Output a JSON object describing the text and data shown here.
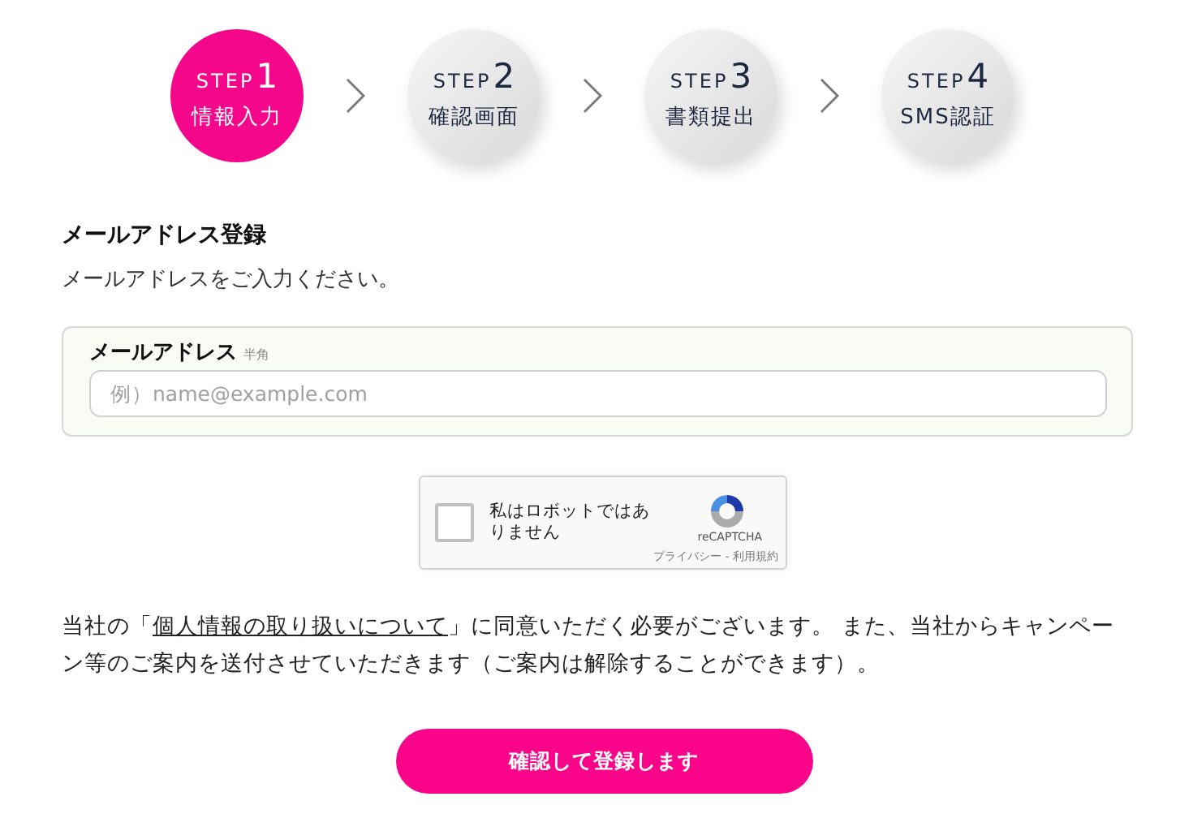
{
  "steps": [
    {
      "label": "STEP",
      "number": "1",
      "name": "情報入力",
      "selected": true
    },
    {
      "label": "STEP",
      "number": "2",
      "name": "確認画面",
      "selected": false
    },
    {
      "label": "STEP",
      "number": "3",
      "name": "書類提出",
      "selected": false
    },
    {
      "label": "STEP",
      "number": "4",
      "name": "SMS認証",
      "selected": false
    }
  ],
  "heading": "メールアドレス登録",
  "subtitle": "メールアドレスをご入力ください。",
  "email_field": {
    "label": "メールアドレス",
    "note": "半角",
    "placeholder": "例）name@example.com"
  },
  "captcha": {
    "checked": false,
    "label": "私はロボットではありません",
    "brand": "reCAPTCHA",
    "links": "プライバシー - 利用規約"
  },
  "consent": {
    "before": "当社の「",
    "link": "個人情報の取り扱いについて",
    "after": "」に同意いただく必要がございます。 また、当社からキャンペーン等のご案内を送付させていただきます（ご案内は解除することができます）。"
  },
  "submit": "確認して登録します"
}
